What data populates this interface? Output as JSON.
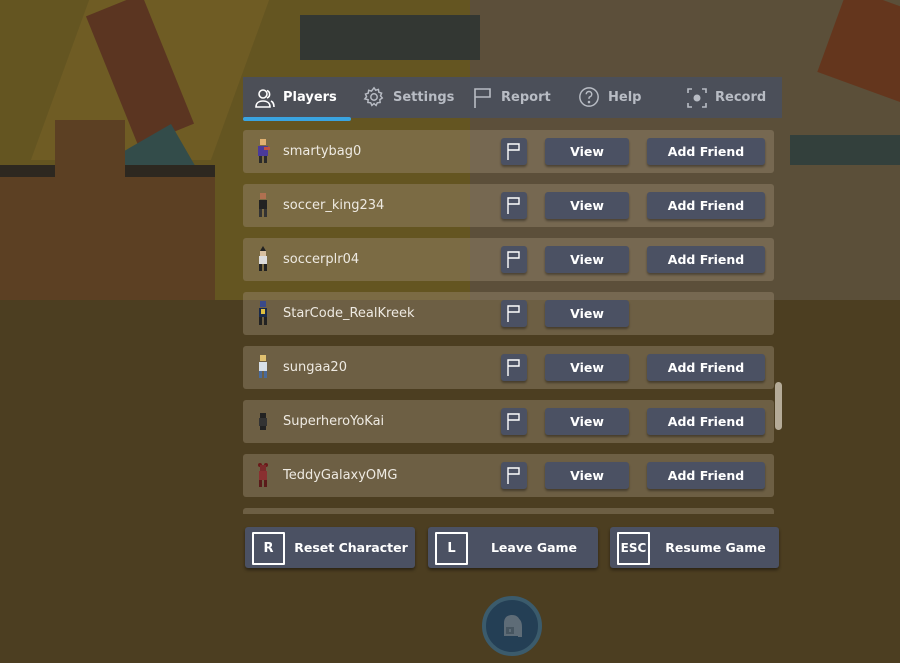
{
  "tabs": [
    {
      "id": "players",
      "label": "Players",
      "icon": "players-icon",
      "active": true
    },
    {
      "id": "settings",
      "label": "Settings",
      "icon": "gear-icon",
      "active": false
    },
    {
      "id": "report",
      "label": "Report",
      "icon": "flag-icon",
      "active": false
    },
    {
      "id": "help",
      "label": "Help",
      "icon": "help-icon",
      "active": false
    },
    {
      "id": "record",
      "label": "Record",
      "icon": "record-icon",
      "active": false
    }
  ],
  "players": [
    {
      "name": "smartybag0",
      "view_label": "View",
      "add_friend_label": "Add Friend",
      "can_add_friend": true
    },
    {
      "name": "soccer_king234",
      "view_label": "View",
      "add_friend_label": "Add Friend",
      "can_add_friend": true
    },
    {
      "name": "soccerplr04",
      "view_label": "View",
      "add_friend_label": "Add Friend",
      "can_add_friend": true
    },
    {
      "name": "StarCode_RealKreek",
      "view_label": "View",
      "add_friend_label": null,
      "can_add_friend": false
    },
    {
      "name": "sungaa20",
      "view_label": "View",
      "add_friend_label": "Add Friend",
      "can_add_friend": true
    },
    {
      "name": "SuperheroYoKai",
      "view_label": "View",
      "add_friend_label": "Add Friend",
      "can_add_friend": true
    },
    {
      "name": "TeddyGalaxyOMG",
      "view_label": "View",
      "add_friend_label": "Add Friend",
      "can_add_friend": true
    }
  ],
  "actions": [
    {
      "key": "R",
      "label": "Reset Character"
    },
    {
      "key": "L",
      "label": "Leave Game"
    },
    {
      "key": "ESC",
      "label": "Resume Game"
    }
  ],
  "colors": {
    "accent": "#3aa4e0",
    "button": "#4b5163",
    "tabbar": "#4a4f5c"
  }
}
